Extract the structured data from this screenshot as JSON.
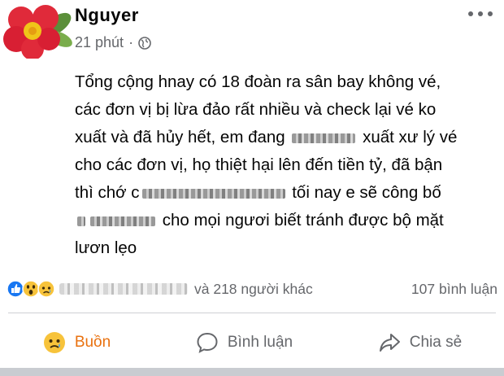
{
  "post": {
    "author": "Nguyer",
    "time": "21 phút",
    "separator": "·",
    "text_lines": [
      "Tổng cộng hnay có 18 đoàn ra sân bay không vé,",
      "các đơn vị bị lừa đảo rất nhiều và check lại vé ko",
      [
        "xuất và đã hủy hết, em đang ",
        " xuất xư lý vé"
      ],
      "cho các đơn vị, họ thiệt hại lên đến tiền tỷ, đã bận",
      [
        "thì chớ c",
        " tối nay e sẽ công bố"
      ],
      [
        "",
        " cho mọi ngươi biết tránh được bộ mặt"
      ],
      "lươn lẹo"
    ]
  },
  "reactions": {
    "others": "và 218 người khác",
    "comments": "107 bình luận"
  },
  "actions": {
    "react_label": "Buồn",
    "comment_label": "Bình luận",
    "share_label": "Chia sẻ"
  },
  "colors": {
    "sad_reaction": "#e9710f",
    "meta_grey": "#65676b",
    "like_blue": "#1877f2"
  },
  "icons": [
    "flower-avatar",
    "globe-icon",
    "more-options-icon",
    "like-reaction-icon",
    "wow-reaction-icon",
    "sad-reaction-icon",
    "sad-emoji-icon",
    "comment-icon",
    "share-icon"
  ]
}
